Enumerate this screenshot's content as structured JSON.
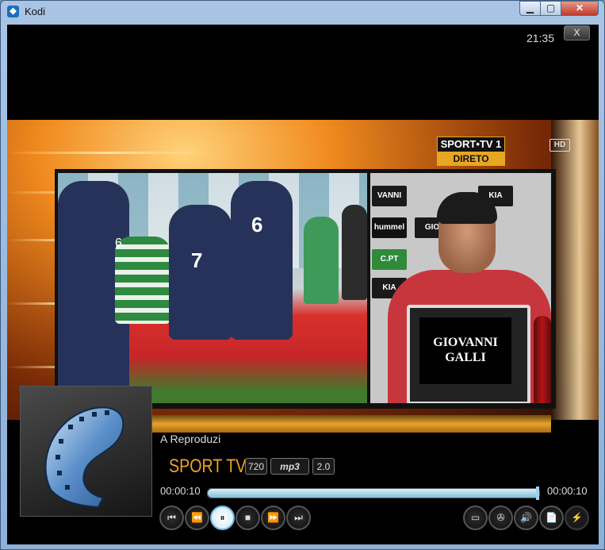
{
  "window": {
    "title": "Kodi",
    "controls": {
      "minimize": "▁",
      "maximize": "▢",
      "close": "✕"
    }
  },
  "kodi": {
    "clock": "21:35",
    "close_label": "X"
  },
  "overlay": {
    "channel_badge_top": "SPORT•TV 1",
    "channel_badge_bottom": "DIRETO",
    "hd_label": "HD"
  },
  "video_text": {
    "nameplate": "GIOVANNI GALLI",
    "jersey_left": "7",
    "jersey_right": "6",
    "jersey_green": "6",
    "sponsors": [
      "VANNI",
      "KIA",
      "GIO",
      "hummel",
      "C.PT",
      "KIA"
    ]
  },
  "player": {
    "status": "A Reproduzi",
    "channel_name": "SPORT TV 1",
    "tags": {
      "resolution": "720",
      "audio_codec": "mp3",
      "channels": "2.0"
    },
    "elapsed": "00:00:10",
    "total": "00:00:10",
    "progress": 1.0,
    "transport": {
      "skip_back": "⏮",
      "rewind": "⏪",
      "pause": "⏸",
      "stop": "■",
      "fast_forward": "⏩",
      "skip_forward": "⏭"
    },
    "options": {
      "subtitles": "▭",
      "video_settings": "✇",
      "audio": "🔊",
      "info": "📄",
      "record": "⚡"
    }
  },
  "colors": {
    "accent": "#f0a226",
    "seek_fill": "#9fd2ea",
    "active_button": "#6fb8e4"
  }
}
